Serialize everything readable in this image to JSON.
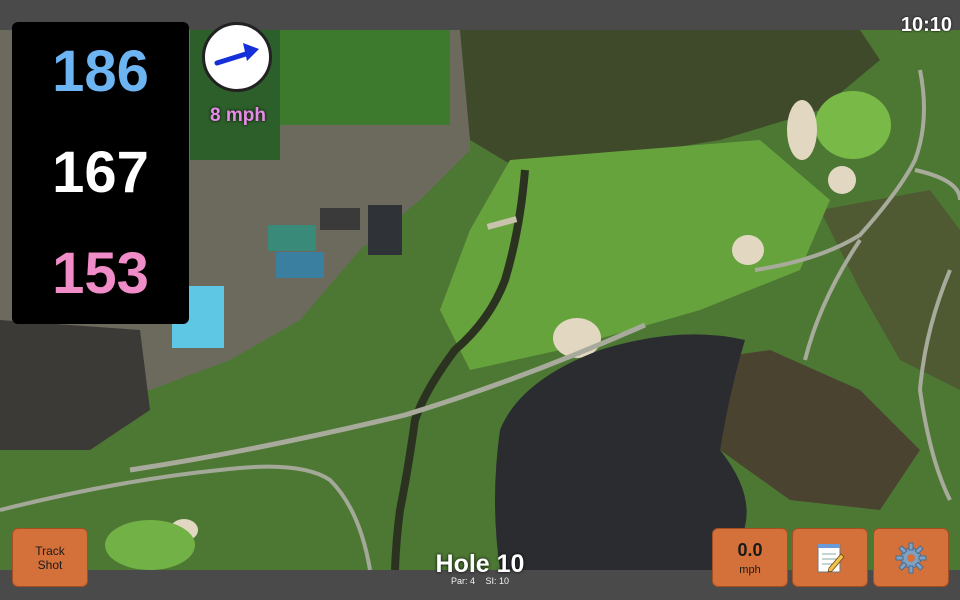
{
  "status_bar": {
    "time": "10:10"
  },
  "yardages": {
    "back": "186",
    "center": "167",
    "front": "153"
  },
  "wind": {
    "speed": "8 mph",
    "direction_icon": "arrow-east-icon"
  },
  "buttons": {
    "track_shot": [
      "Track",
      "Shot"
    ],
    "speed_value": "0.0",
    "speed_unit": "mph",
    "notes_icon": "notepad-icon",
    "settings_icon": "gear-icon"
  },
  "hole": {
    "title": "Hole 10",
    "par": "Par: 4",
    "si": "SI: 10"
  },
  "colors": {
    "back": "#6cb4f2",
    "center": "#ffffff",
    "front": "#f08cc8",
    "button": "#d4703a",
    "wind": "#e88be8"
  }
}
